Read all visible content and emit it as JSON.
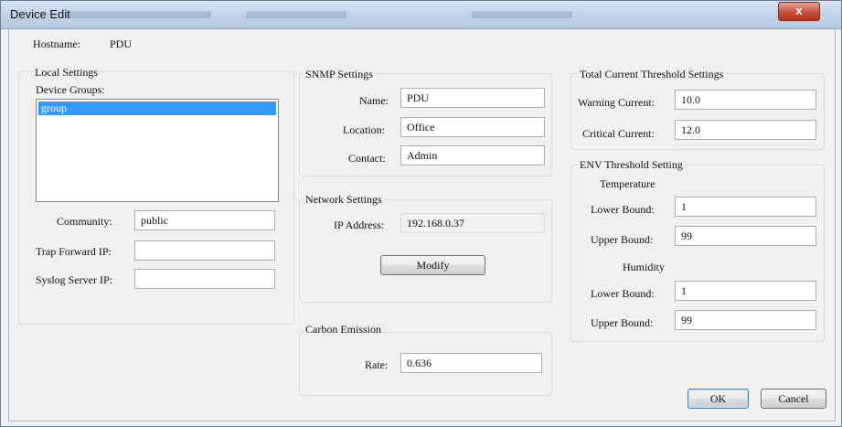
{
  "window": {
    "title": "Device Edit",
    "close_label": "x"
  },
  "hostname": {
    "label": "Hostname:",
    "value": "PDU"
  },
  "local_settings": {
    "title": "Local Settings",
    "device_groups_label": "Device Groups:",
    "groups": [
      "group"
    ],
    "community_label": "Community:",
    "community_value": "public",
    "trap_forward_label": "Trap Forward IP:",
    "trap_forward_value": "",
    "syslog_label": "Syslog Server IP:",
    "syslog_value": ""
  },
  "snmp": {
    "title": "SNMP Settings",
    "name_label": "Name:",
    "name_value": "PDU",
    "location_label": "Location:",
    "location_value": "Office",
    "contact_label": "Contact:",
    "contact_value": "Admin"
  },
  "network": {
    "title": "Network Settings",
    "ip_label": "IP Address:",
    "ip_value": "192.168.0.37",
    "modify_label": "Modify"
  },
  "carbon": {
    "title": "Carbon Emission",
    "rate_label": "Rate:",
    "rate_value": "0.636"
  },
  "current": {
    "title": "Total Current Threshold Settings",
    "warning_label": "Warning Current:",
    "warning_value": "10.0",
    "critical_label": "Critical Current:",
    "critical_value": "12.0"
  },
  "env": {
    "title": "ENV Threshold Setting",
    "temperature_label": "Temperature",
    "temp_lower_label": "Lower Bound:",
    "temp_lower_value": "1",
    "temp_upper_label": "Upper Bound:",
    "temp_upper_value": "99",
    "humidity_label": "Humidity",
    "hum_lower_label": "Lower Bound:",
    "hum_lower_value": "1",
    "hum_upper_label": "Upper Bound:",
    "hum_upper_value": "99"
  },
  "buttons": {
    "ok": "OK",
    "cancel": "Cancel"
  }
}
